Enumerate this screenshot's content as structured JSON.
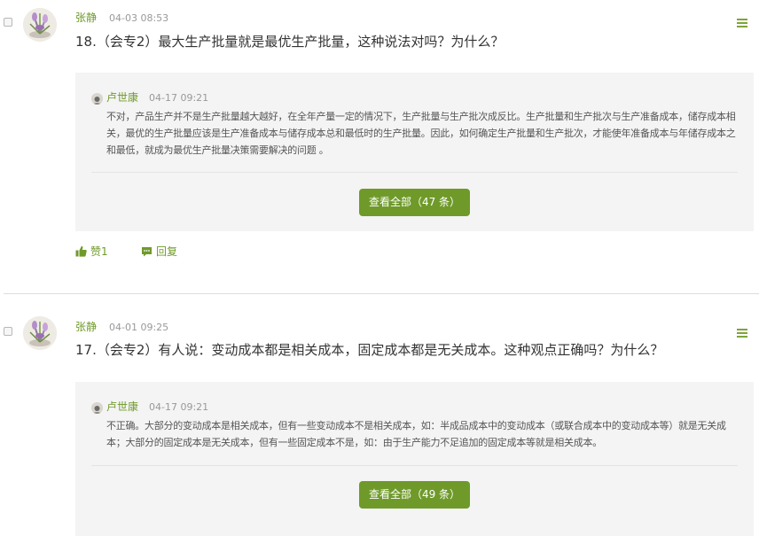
{
  "posts": [
    {
      "author": "张静",
      "timestamp": "04-03 08:53",
      "question": "18.（会专2）最大生产批量就是最优生产批量，这种说法对吗？为什么？",
      "answer": {
        "author": "卢世康",
        "timestamp": "04-17 09:21",
        "text": "不对，产品生产并不是生产批量越大越好，在全年产量一定的情况下，生产批量与生产批次成反比。生产批量和生产批次与生产准备成本，储存成本相关，最优的生产批量应该是生产准备成本与储存成本总和最低时的生产批量。因此，如何确定生产批量和生产批次，才能使年准备成本与年储存成本之和最低，就成为最优生产批量决策需要解决的问题 。"
      },
      "view_all_label": "查看全部（47 条）",
      "like_label": "赞1",
      "reply_label": "回复"
    },
    {
      "author": "张静",
      "timestamp": "04-01 09:25",
      "question": "17.（会专2）有人说：变动成本都是相关成本，固定成本都是无关成本。这种观点正确吗？为什么？",
      "answer": {
        "author": "卢世康",
        "timestamp": "04-17 09:21",
        "text": "不正确。大部分的变动成本是相关成本，但有一些变动成本不是相关成本，如：半成品成本中的变动成本（或联合成本中的变动成本等）就是无关成本；大部分的固定成本是无关成本，但有一些固定成本不是，如：由于生产能力不足追加的固定成本等就是相关成本。"
      },
      "view_all_label": "查看全部（49 条）"
    }
  ],
  "colors": {
    "accent": "#6f9a2a",
    "menu_icon": "#7ea43b",
    "answer_background": "#f4f4f4",
    "timestamp": "#999999"
  },
  "icons": {
    "menu": "hamburger-menu-icon",
    "like": "thumbs-up-icon",
    "reply": "speech-bubble-icon"
  }
}
